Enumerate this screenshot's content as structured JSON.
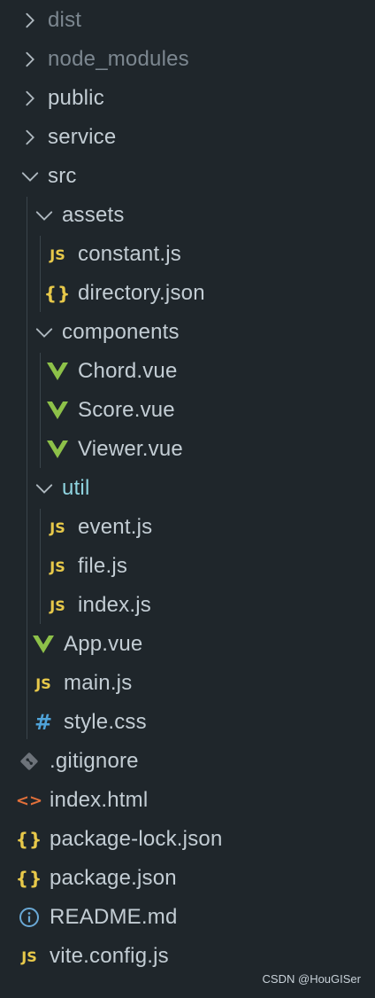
{
  "explorer": {
    "items": [
      {
        "label": "dist",
        "kind": "folder",
        "open": false,
        "icon": "chevron-right-icon"
      },
      {
        "label": "node_modules",
        "kind": "folder",
        "open": false,
        "icon": "chevron-right-icon"
      },
      {
        "label": "public",
        "kind": "folder",
        "open": false,
        "icon": "chevron-right-icon"
      },
      {
        "label": "service",
        "kind": "folder",
        "open": false,
        "icon": "chevron-right-icon"
      },
      {
        "label": "src",
        "kind": "folder",
        "open": true,
        "icon": "chevron-down-icon"
      },
      {
        "label": "assets",
        "kind": "folder",
        "open": true,
        "icon": "chevron-down-icon"
      },
      {
        "label": "constant.js",
        "kind": "file",
        "icon": "js-file-icon",
        "glyph": "JS"
      },
      {
        "label": "directory.json",
        "kind": "file",
        "icon": "json-file-icon",
        "glyph": "{}"
      },
      {
        "label": "components",
        "kind": "folder",
        "open": true,
        "icon": "chevron-down-icon"
      },
      {
        "label": "Chord.vue",
        "kind": "file",
        "icon": "vue-file-icon"
      },
      {
        "label": "Score.vue",
        "kind": "file",
        "icon": "vue-file-icon"
      },
      {
        "label": "Viewer.vue",
        "kind": "file",
        "icon": "vue-file-icon"
      },
      {
        "label": "util",
        "kind": "folder",
        "open": true,
        "icon": "chevron-down-icon"
      },
      {
        "label": "event.js",
        "kind": "file",
        "icon": "js-file-icon",
        "glyph": "JS"
      },
      {
        "label": "file.js",
        "kind": "file",
        "icon": "js-file-icon",
        "glyph": "JS"
      },
      {
        "label": "index.js",
        "kind": "file",
        "icon": "js-file-icon",
        "glyph": "JS"
      },
      {
        "label": "App.vue",
        "kind": "file",
        "icon": "vue-file-icon"
      },
      {
        "label": "main.js",
        "kind": "file",
        "icon": "js-file-icon",
        "glyph": "JS"
      },
      {
        "label": "style.css",
        "kind": "file",
        "icon": "css-file-icon",
        "glyph": "#"
      },
      {
        "label": ".gitignore",
        "kind": "file",
        "icon": "git-file-icon"
      },
      {
        "label": "index.html",
        "kind": "file",
        "icon": "html-file-icon",
        "glyph": "<>"
      },
      {
        "label": "package-lock.json",
        "kind": "file",
        "icon": "json-file-icon",
        "glyph": "{}"
      },
      {
        "label": "package.json",
        "kind": "file",
        "icon": "json-file-icon",
        "glyph": "{}"
      },
      {
        "label": "README.md",
        "kind": "file",
        "icon": "info-file-icon"
      },
      {
        "label": "vite.config.js",
        "kind": "file",
        "icon": "js-file-icon",
        "glyph": "JS"
      }
    ]
  },
  "colors": {
    "background": "#1f262b",
    "text": "#c3cdd4",
    "dim_text": "#7c8790",
    "active_text": "#8fd4e0",
    "js": "#e8c94a",
    "vue": "#8dc149",
    "css": "#4fa3d9",
    "html": "#e2703a",
    "git": "#6d737a",
    "info": "#6aa9d6"
  },
  "watermark": "CSDN @HouGISer"
}
